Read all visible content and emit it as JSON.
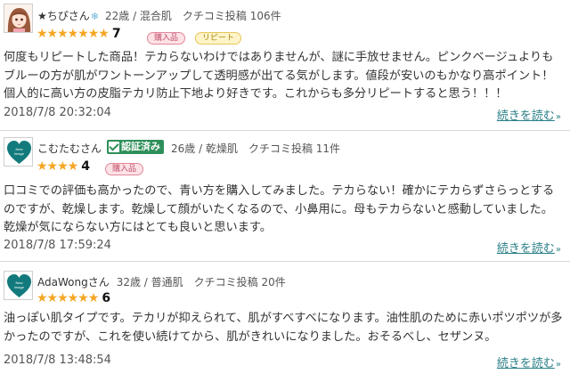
{
  "reviews": [
    {
      "avatar": "anime-girl-avatar",
      "user": "★ちぴさん",
      "user_icon": "snowflake-icon",
      "meta": "22歳 / 混合肌　クチコミ投稿 106件",
      "rating": 7,
      "rating_label": "7",
      "badges": [
        "購入品",
        "リピート"
      ],
      "text": "何度もリピートした商品！テカらないわけではありませんが、謎に手放せません。ピンクベージュよりもブルーの方が肌がワントーンアップして透明感が出てる気がします。値段が安いのもかなり高ポイント！個人的に高い方の皮脂テカリ防止下地より好きです。これからも多分リピートすると思う！！！",
      "date": "2018/7/8 20:32:04",
      "more": "続きを読む"
    },
    {
      "avatar": "brand-logo-avatar",
      "user": "こむたむさん",
      "verified": "認証済み",
      "meta": "26歳 / 乾燥肌　クチコミ投稿 11件",
      "rating": 4,
      "rating_label": "4",
      "badges": [
        "購入品"
      ],
      "text": "口コミでの評価も高かったので、青い方を購入してみました。テカらない！確かにテカらずさらっとするのですが、乾燥します。乾燥して顔がいたくなるので、小鼻用に。母もテカらないと感動していました。乾燥が気にならない方にはとても良いと思います。",
      "date": "2018/7/8 17:59:24",
      "more": "続きを読む"
    },
    {
      "avatar": "brand-logo-avatar",
      "user": "AdaWongさん",
      "meta": "32歳 / 普通肌　クチコミ投稿 20件",
      "rating": 6,
      "rating_label": "6",
      "badges": [],
      "text": "油っぽい肌タイプです。テカリが抑えられて、肌がすべすべになります。油性肌のために赤いポツポツが多かったのですが、これを使い続けてから、肌がきれいになりました。おそるべし、セザンヌ。",
      "date": "2018/7/8 13:48:54",
      "more": "続きを読む"
    }
  ],
  "colors": {
    "star": "#f5a623",
    "link": "#2a7f86",
    "verified": "#2f8f5a",
    "purchase_bg": "#fde2e6",
    "repeat_bg": "#fff4c8"
  }
}
